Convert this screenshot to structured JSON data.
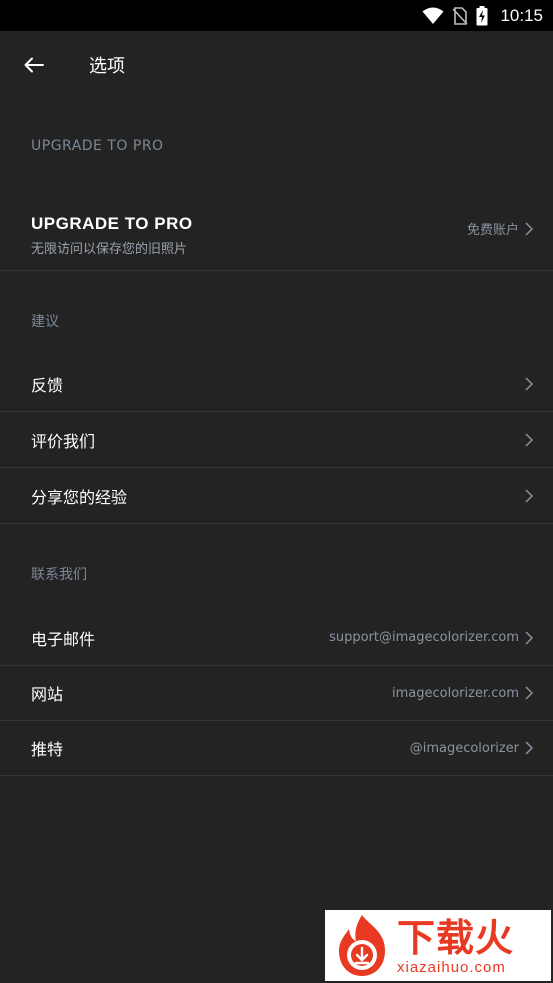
{
  "status_bar": {
    "time": "10:15",
    "icons": [
      "wifi-icon",
      "no-sim-icon",
      "battery-charging-icon"
    ]
  },
  "app_bar": {
    "back_icon": "arrow-left-icon",
    "title": "选项"
  },
  "sections": {
    "upgrade": {
      "header": "UPGRADE TO PRO",
      "item": {
        "title": "UPGRADE TO PRO",
        "subtitle": "无限访问以保存您的旧照片",
        "status": "免费账户"
      }
    },
    "suggestions": {
      "header": "建议",
      "items": [
        {
          "label": "反馈"
        },
        {
          "label": "评价我们"
        },
        {
          "label": "分享您的经验"
        }
      ]
    },
    "contact": {
      "header": "联系我们",
      "items": [
        {
          "label": "电子邮件",
          "value": "support@imagecolorizer.com"
        },
        {
          "label": "网站",
          "value": "imagecolorizer.com"
        },
        {
          "label": "推特",
          "value": "@imagecolorizer"
        }
      ]
    }
  },
  "watermark": {
    "main": "下载火",
    "sub": "xiazaihuo.com"
  },
  "colors": {
    "background": "#232323",
    "status_bar": "#000000",
    "section_header": "#7c8796",
    "divider": "#353535",
    "watermark_red": "#e83a22"
  }
}
